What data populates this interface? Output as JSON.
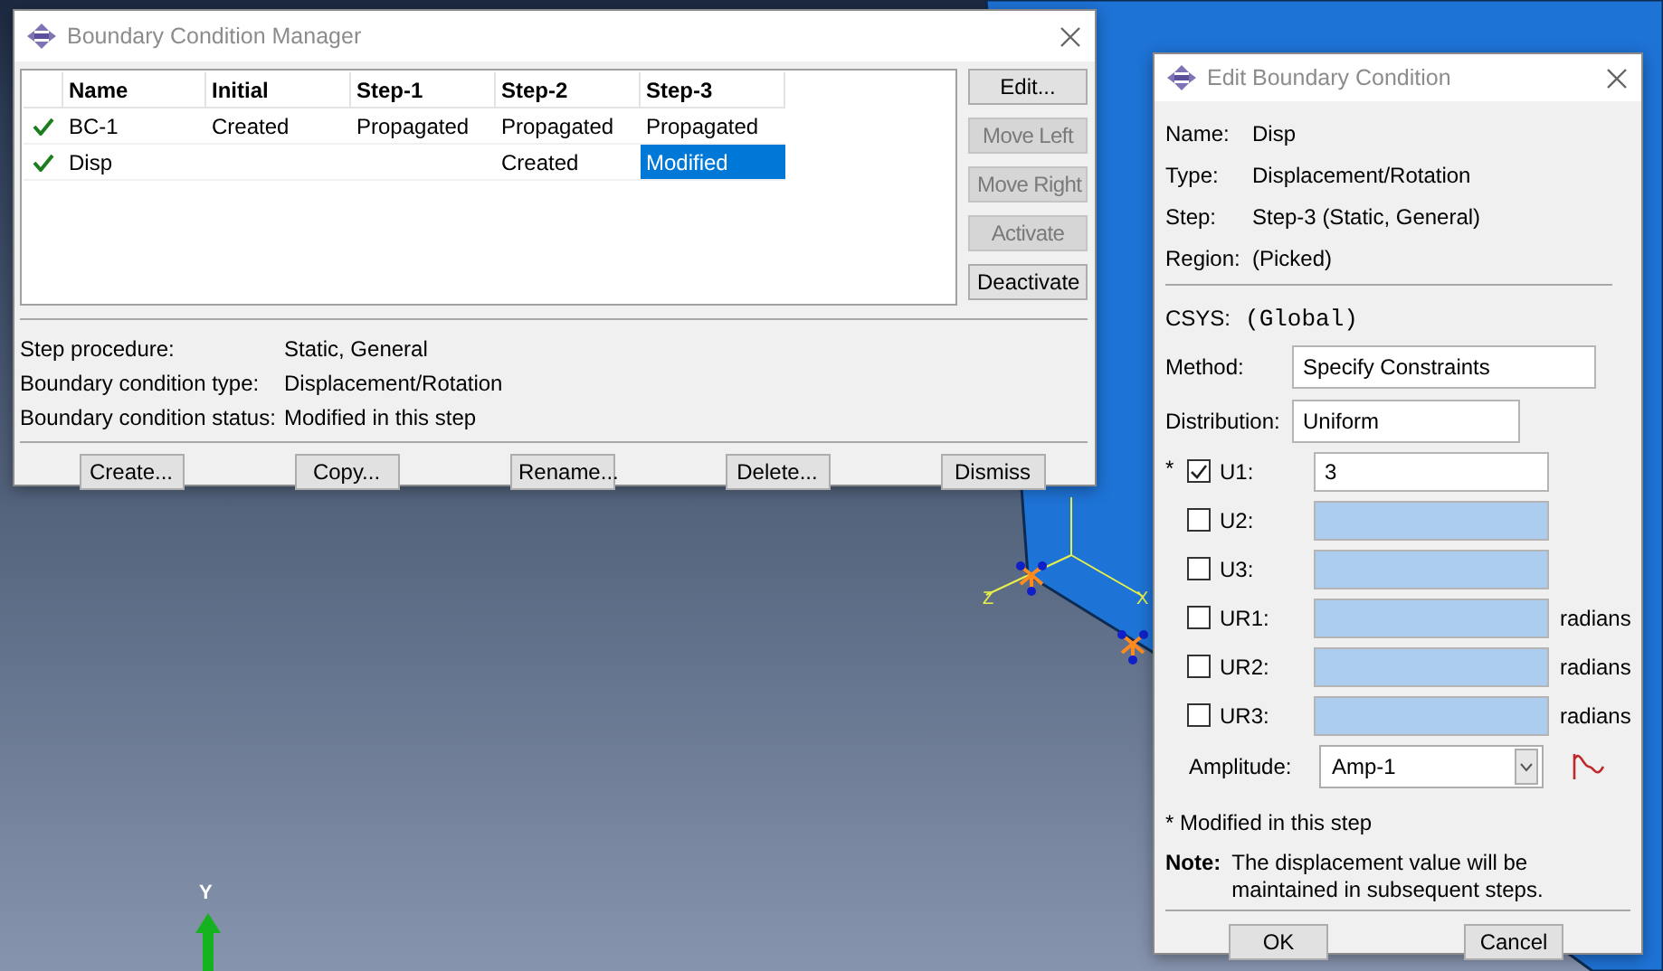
{
  "viewport": {
    "triad_label": "Y",
    "csys_labels": [
      "Z",
      "X"
    ]
  },
  "manager": {
    "title": "Boundary Condition Manager",
    "columns": [
      "Name",
      "Initial",
      "Step-1",
      "Step-2",
      "Step-3"
    ],
    "rows": [
      {
        "active": true,
        "cells": [
          {
            "text": "BC-1",
            "selected": false
          },
          {
            "text": "Created",
            "selected": false
          },
          {
            "text": "Propagated",
            "selected": false
          },
          {
            "text": "Propagated",
            "selected": false
          },
          {
            "text": "Propagated",
            "selected": false
          }
        ]
      },
      {
        "active": true,
        "cells": [
          {
            "text": "Disp",
            "selected": false
          },
          {
            "text": "",
            "selected": false
          },
          {
            "text": "",
            "selected": false
          },
          {
            "text": "Created",
            "selected": false
          },
          {
            "text": "Modified",
            "selected": true
          }
        ]
      }
    ],
    "side_buttons": [
      {
        "label": "Edit...",
        "disabled": false
      },
      {
        "label": "Move Left",
        "disabled": true
      },
      {
        "label": "Move Right",
        "disabled": true
      },
      {
        "label": "Activate",
        "disabled": true
      },
      {
        "label": "Deactivate",
        "disabled": false
      }
    ],
    "info": [
      {
        "label": "Step procedure:",
        "value": "Static, General"
      },
      {
        "label": "Boundary condition type:",
        "value": "Displacement/Rotation"
      },
      {
        "label": "Boundary condition status:",
        "value": "Modified in this step"
      }
    ],
    "buttons": [
      "Create...",
      "Copy...",
      "Rename...",
      "Delete...",
      "Dismiss"
    ]
  },
  "editor": {
    "title": "Edit Boundary Condition",
    "fields": [
      {
        "label": "Name:",
        "value": "Disp"
      },
      {
        "label": "Type:",
        "value": "Displacement/Rotation"
      },
      {
        "label": "Step:",
        "value": "Step-3 (Static, General)"
      },
      {
        "label": "Region:",
        "value": "(Picked)"
      }
    ],
    "csys": {
      "label": "CSYS:",
      "value": "(Global)"
    },
    "method": {
      "label": "Method:",
      "value": "Specify Constraints"
    },
    "distribution": {
      "label": "Distribution:",
      "value": "Uniform"
    },
    "components": [
      {
        "marker": "*",
        "label": "U1:",
        "checked": true,
        "value": "3"
      },
      {
        "label": "U2:",
        "checked": false
      },
      {
        "label": "U3:",
        "checked": false
      },
      {
        "label": "UR1:",
        "checked": false,
        "unit": "radians"
      },
      {
        "label": "UR2:",
        "checked": false,
        "unit": "radians"
      },
      {
        "label": "UR3:",
        "checked": false,
        "unit": "radians"
      }
    ],
    "amplitude": {
      "label": "Amplitude:",
      "value": "Amp-1"
    },
    "footnote": "* Modified in this step",
    "note": {
      "label": "Note:",
      "text": "The displacement value will be maintained in subsequent steps."
    },
    "buttons": [
      "OK",
      "Cancel"
    ]
  }
}
